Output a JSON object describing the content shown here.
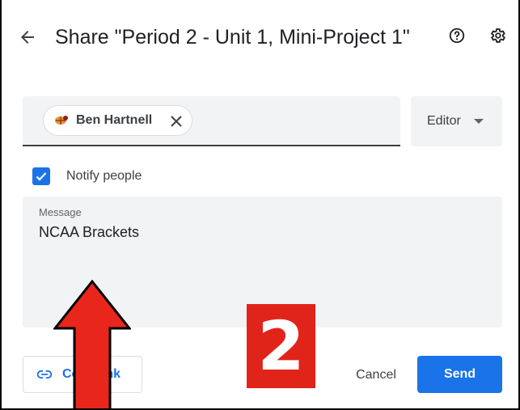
{
  "dialog": {
    "title": "Share \"Period 2 - Unit 1, Mini-Project 1\""
  },
  "recipient_chip": {
    "name": "Ben Hartnell"
  },
  "role": {
    "selected": "Editor"
  },
  "notify": {
    "label": "Notify people",
    "checked": true
  },
  "message": {
    "label": "Message",
    "value": "NCAA Brackets"
  },
  "footer": {
    "copy_link_label": "Copy link",
    "cancel_label": "Cancel",
    "send_label": "Send"
  },
  "overlay": {
    "step_number": "2"
  },
  "colors": {
    "accent": "#1a73e8",
    "annotation_red": "#e0241a"
  }
}
